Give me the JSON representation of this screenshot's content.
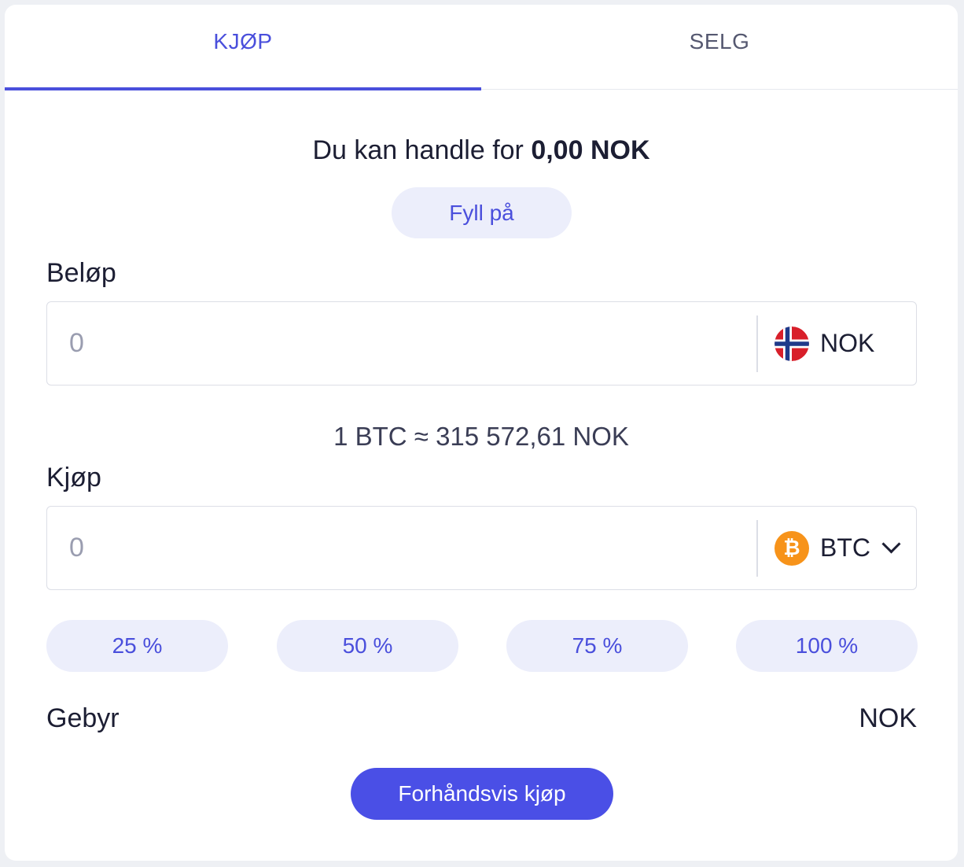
{
  "tabs": [
    {
      "label": "KJØP",
      "active": true
    },
    {
      "label": "SELG",
      "active": false
    }
  ],
  "balance": {
    "prefix": "Du kan handle for",
    "amount": "0,00 NOK"
  },
  "fill_button": "Fyll på",
  "amount_field": {
    "label": "Beløp",
    "value": "0",
    "currency": "NOK",
    "currency_icon": "norway-flag-icon"
  },
  "rate_text": "1 BTC ≈ 315 572,61 NOK",
  "buy_field": {
    "label": "Kjøp",
    "value": "0",
    "currency": "BTC",
    "currency_icon": "bitcoin-icon",
    "btc_symbol": "₿"
  },
  "percent_buttons": [
    "25 %",
    "50 %",
    "75 %",
    "100 %"
  ],
  "fee": {
    "label": "Gebyr",
    "value": "NOK"
  },
  "preview_button": "Forhåndsvis kjøp",
  "colors": {
    "accent": "#4a4fdc",
    "button_bg": "#eceefb",
    "primary_button": "#4a4fe6",
    "bitcoin": "#f7931a"
  }
}
